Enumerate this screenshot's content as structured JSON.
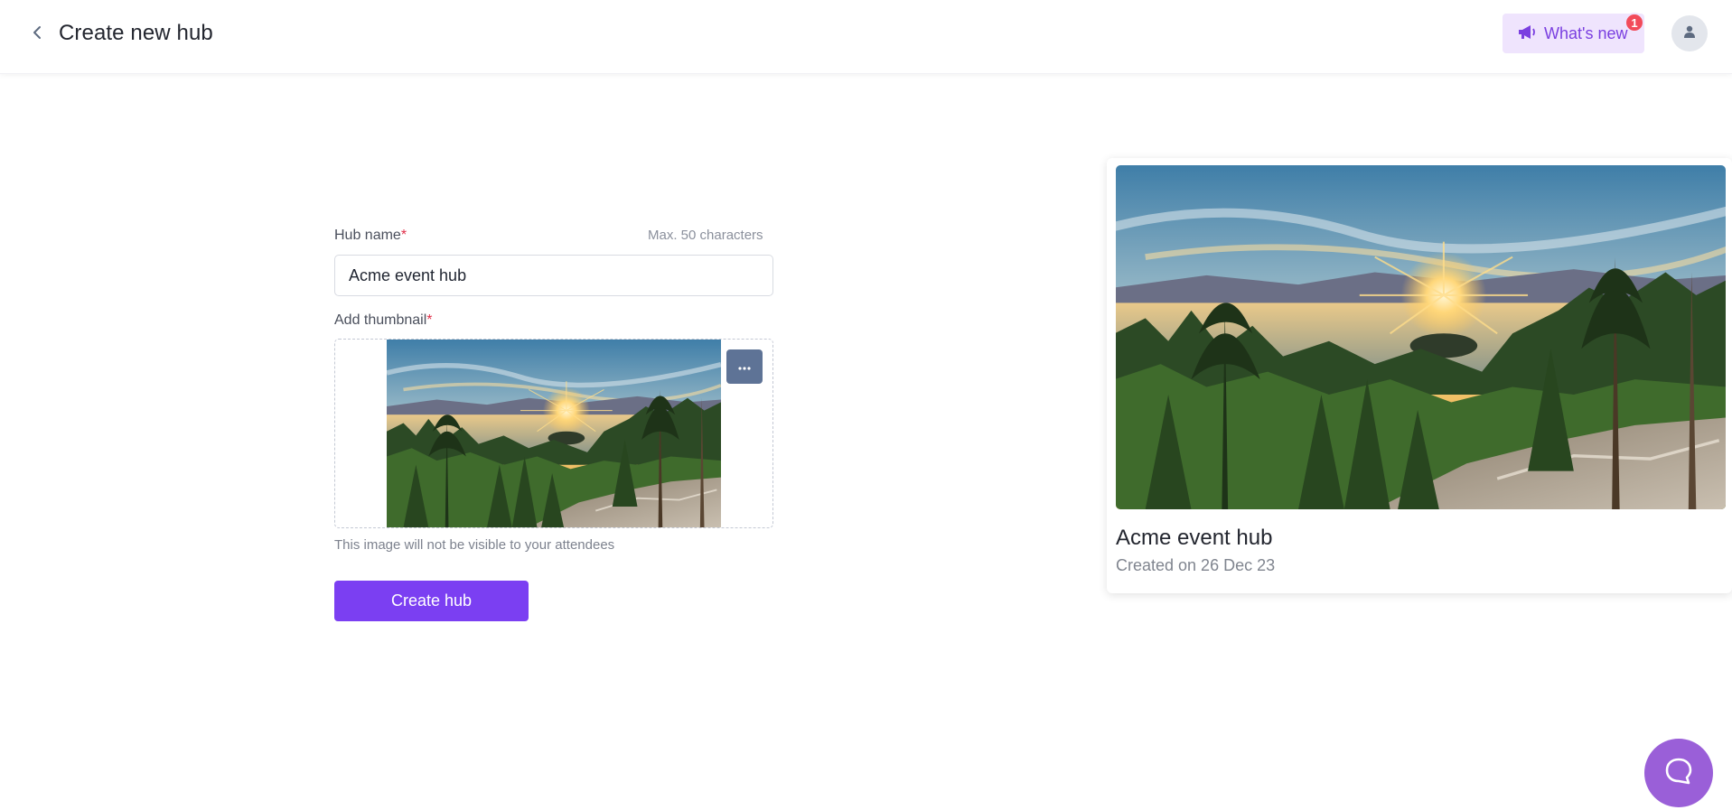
{
  "header": {
    "title": "Create new hub",
    "back_icon": "chevron-left-icon",
    "whats_new": {
      "label": "What's new",
      "icon": "megaphone-icon",
      "badge_count": "1"
    },
    "avatar_icon": "user-icon"
  },
  "form": {
    "hub_name": {
      "label": "Hub name",
      "required_mark": "*",
      "hint": "Max. 50 characters",
      "value": "Acme event hub"
    },
    "thumbnail": {
      "label": "Add thumbnail",
      "required_mark": "*",
      "more_icon": "more-horizontal-icon",
      "hint": "This image will not be visible to your attendees"
    },
    "submit_label": "Create hub"
  },
  "preview": {
    "title": "Acme event hub",
    "created": "Created on 26 Dec 23"
  },
  "chat": {
    "icon": "chat-bubble-icon"
  },
  "colors": {
    "accent": "#7b3ff2",
    "whats_new_bg": "#efe4fd",
    "badge": "#f24b5a",
    "chat": "#9a5fd8"
  }
}
